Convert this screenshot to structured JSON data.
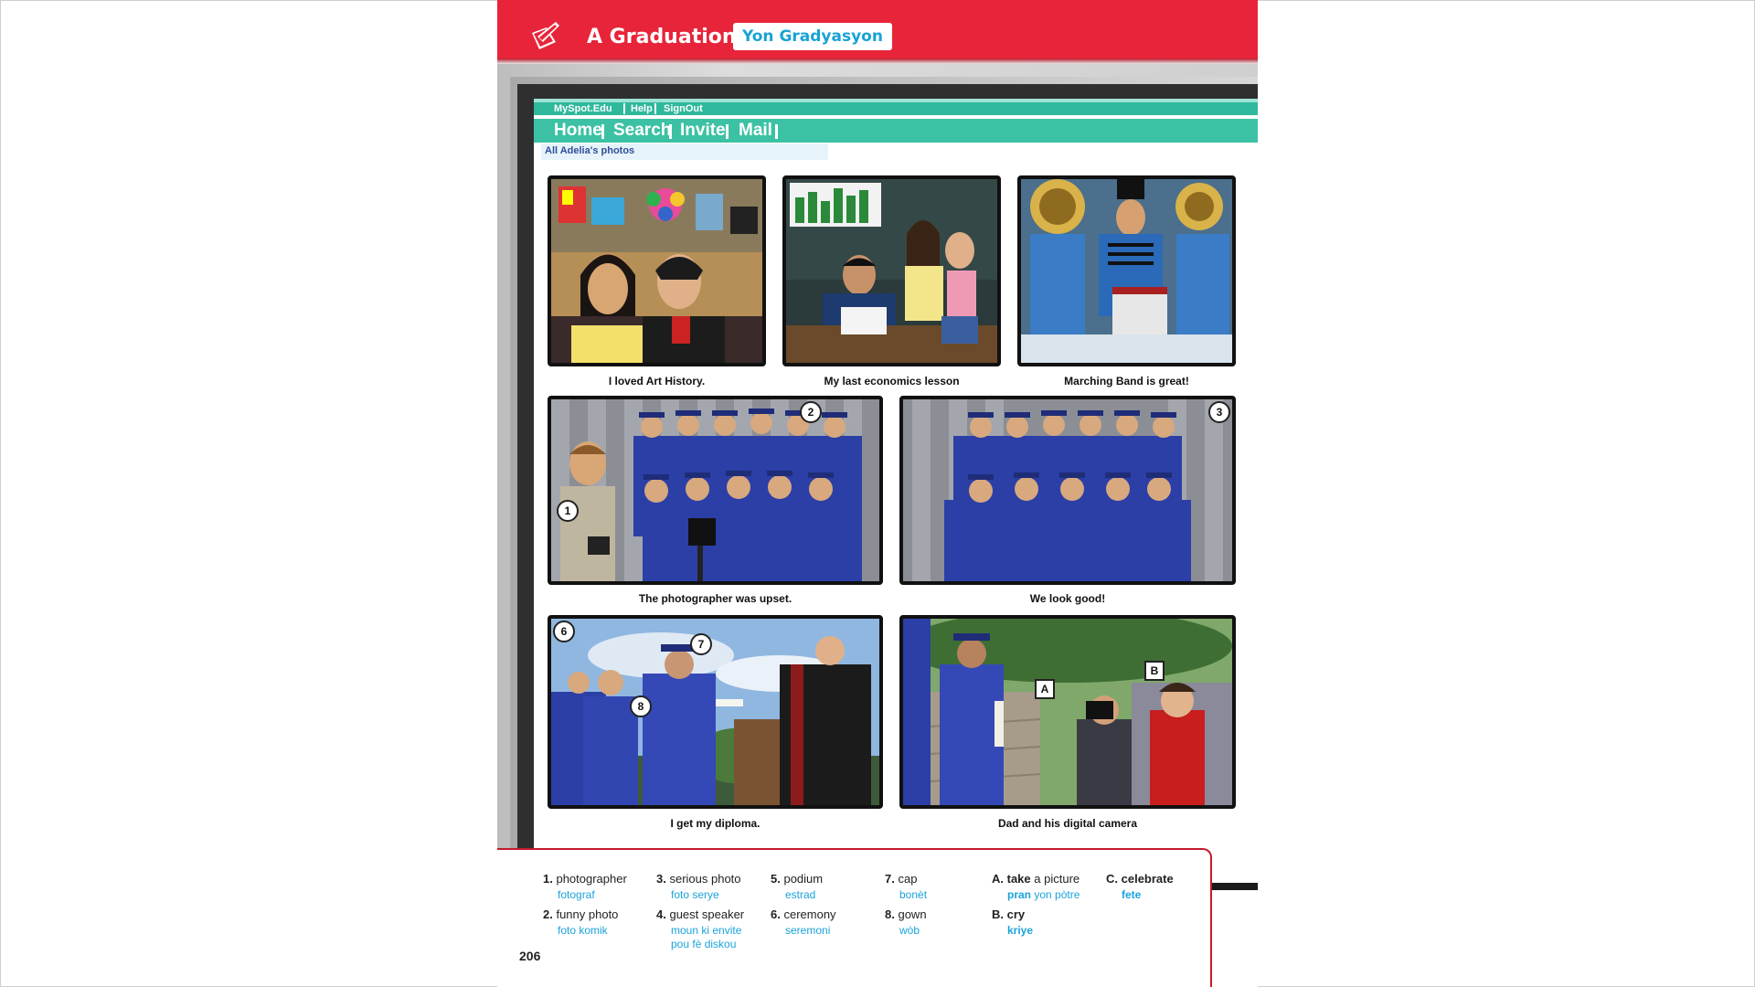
{
  "header": {
    "title": "A Graduation",
    "subtitle": "Yon Gradyasyon"
  },
  "browser": {
    "top_links": [
      "MySpot.Edu",
      "Help",
      "SignOut"
    ],
    "main_nav": [
      "Home",
      "Search",
      "Invite",
      "Mail"
    ],
    "album_label": "All Adelia's photos"
  },
  "photos": [
    {
      "caption": "I loved Art History."
    },
    {
      "caption": "My last economics lesson"
    },
    {
      "caption": "Marching Band is great!"
    },
    {
      "caption": "The photographer was upset."
    },
    {
      "caption": "We look good!"
    },
    {
      "caption": "I get my diploma."
    },
    {
      "caption": "Dad and his digital camera"
    }
  ],
  "markers": {
    "m1": "1",
    "m2": "2",
    "m3": "3",
    "m6": "6",
    "m7": "7",
    "m8": "8",
    "mA": "A",
    "mB": "B"
  },
  "vocab": [
    {
      "num": "1.",
      "en": "photographer",
      "ht": "fotograf"
    },
    {
      "num": "2.",
      "en": "funny photo",
      "ht": "foto komik"
    },
    {
      "num": "3.",
      "en": "serious photo",
      "ht": "foto serye"
    },
    {
      "num": "4.",
      "en": "guest speaker",
      "ht": "moun ki envite",
      "ht2": "pou fè diskou"
    },
    {
      "num": "5.",
      "en": "podium",
      "ht": "estrad"
    },
    {
      "num": "6.",
      "en": "ceremony",
      "ht": "seremoni"
    },
    {
      "num": "7.",
      "en": "cap",
      "ht": "bonèt"
    },
    {
      "num": "8.",
      "en": "gown",
      "ht": "wòb"
    }
  ],
  "verbs": [
    {
      "num": "A.",
      "en_bold": "take",
      "en_rest": " a picture",
      "ht_bold": "pran",
      "ht_rest": " yon pòtre"
    },
    {
      "num": "B.",
      "en_bold": "cry",
      "en_rest": "",
      "ht_bold": "kriye",
      "ht_rest": ""
    },
    {
      "num": "C.",
      "en_bold": "celebrate",
      "en_rest": "",
      "ht_bold": "fete",
      "ht_rest": ""
    }
  ],
  "page_number": "206",
  "colors": {
    "header_red": "#e8243a",
    "nav_green": "#3cc1a4",
    "translation_blue": "#1aa3da"
  }
}
